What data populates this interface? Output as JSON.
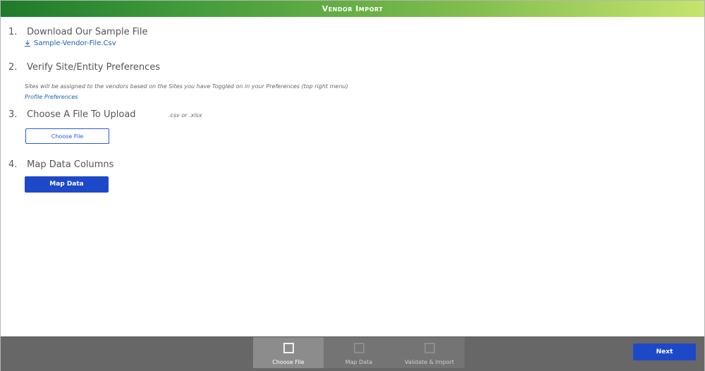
{
  "window": {
    "title": "Vendor Import"
  },
  "steps": [
    {
      "num": "1.",
      "title": "Download Our Sample File"
    },
    {
      "num": "2.",
      "title": "Verify Site/Entity Preferences"
    },
    {
      "num": "3.",
      "title": "Choose A File To Upload"
    },
    {
      "num": "4.",
      "title": "Map Data Columns"
    }
  ],
  "download": {
    "label": "Sample-Vendor-File.Csv",
    "icon": "download-icon"
  },
  "preferences": {
    "note": "Sites will be assigned to the vendors based on the Sites you have Toggled on in your Preferences (top right menu)",
    "link": "Profile Preferences"
  },
  "upload": {
    "hint": ".csv or .xlsx",
    "button": "Choose File"
  },
  "map": {
    "button": "Map Data"
  },
  "wizard": {
    "steps": [
      {
        "label": "Choose File",
        "active": true
      },
      {
        "label": "Map Data",
        "active": false
      },
      {
        "label": "Validate & Import",
        "active": false
      }
    ],
    "next": "Next"
  },
  "colors": {
    "accent": "#1d49c9",
    "link": "#1a5fb4",
    "header_start": "#1f7a2a",
    "header_end": "#c6e46c"
  }
}
